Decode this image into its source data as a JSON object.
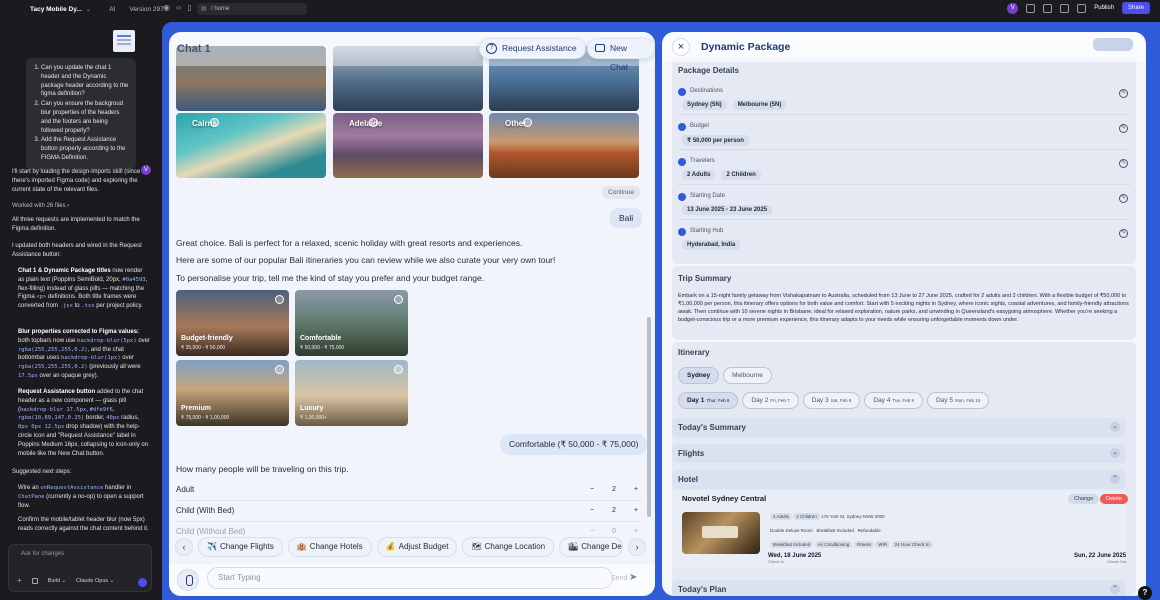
{
  "topbar": {
    "app_title": "Tacy Mobile Dy...",
    "ai_label": "AI",
    "version": "Version 297",
    "url": "/ home",
    "avatar": "V",
    "publish": "Publish",
    "share": "Share"
  },
  "left": {
    "user_points": [
      "Can you update the chat 1 header and the Dynamic package header according to the figma definition?",
      "Can you ensure the backgroud blur properties of the headers and the footers are being followed properly?",
      "Add the Request Assistance button properly according to the FIGMA Definition."
    ],
    "avatar": "V",
    "intro": "I'll start by loading the design-imports skill (since there's imported Figma code) and exploring the current state of the relevant files.",
    "worked": "Worked with 26 files",
    "p1": "All three requests are implemented to match the Figma definition.",
    "p2": "I updated both headers and wired in the Request Assistance button:",
    "b1_title": "Chat 1 & Dynamic Package titles",
    "b1_a": " now render as plain text (Poppins SemiBold, 20px, ",
    "b1_code1": "#0a4593",
    "b1_b": ", flex-filling) instead of glass pills — matching the Figma ",
    "b1_code2": "<p>",
    "b1_c": " definitions. Both title frames were converted from ",
    "b1_code3": ".jsx",
    "b1_d": " to ",
    "b1_code4": ".tsx",
    "b1_e": " per project policy.",
    "b2_title": "Blur properties corrected to Figma values:",
    "b2_a": " both topbars now use ",
    "b2_code1": "backdrop-blur(5px)",
    "b2_b": " over ",
    "b2_code2": "rgba(255,255,255,0.2)",
    "b2_c": ", and the chat bottombar uses ",
    "b2_code3": "backdrop-blur(1px)",
    "b2_d": " over ",
    "b2_code4": "rgba(255,255,255,0.2)",
    "b2_e": " (previously all were ",
    "b2_code5": "17.5px",
    "b2_f": " over an opaque grey).",
    "b3_title": "Request Assistance button",
    "b3_a": " added to the chat header as a new component — glass pill (",
    "b3_code1": "backdrop-blur 17.5px",
    "b3_b": ", ",
    "b3_code2": "#dfe9f6",
    "b3_c": ", ",
    "b3_code3": "rgba(10,69,147,0.25)",
    "b3_d": " border, ",
    "b3_code4": "40px",
    "b3_e": " radius, ",
    "b3_code5": "0px 0px 12.5px",
    "b3_f": " drop shadow) with the help-circle icon and \"Request Assistance\" label in Poppins Medium 16px, collapsing to icon-only on mobile like the New Chat button.",
    "next_title": "Suggested next steps:",
    "n1_a": "Wire an ",
    "n1_code": "onRequestAssistance",
    "n1_b": " handler in ",
    "n1_code2": "ChatPane",
    "n1_c": " (currently a no-op) to open a support flow.",
    "n2": "Confirm the mobile/tablet header blur (now 5px) reads correctly against the chat content behind it.",
    "ask_placeholder": "Ask for changes",
    "build": "Build",
    "model": "Claude Opus"
  },
  "chat": {
    "title": "Chat 1",
    "request_assistance": "Request Assistance",
    "new_chat": "New Chat",
    "cities": [
      {
        "name": "Cairns"
      },
      {
        "name": "Adelaide"
      },
      {
        "name": "Other"
      }
    ],
    "continue": "Continue",
    "user_reply": "Bali",
    "bot_1": "Great choice. Bali is perfect for a relaxed, scenic holiday with great resorts and experiences.",
    "bot_2": "Here are some of our popular Bali itineraries you can review while we also curate your very own tour!",
    "bot_3": "To personalise your trip, tell me the kind of stay you prefer and your budget range.",
    "packages": [
      {
        "title": "Budget-friendly",
        "price": "₹ 35,000 - ₹ 50,000"
      },
      {
        "title": "Comfortable",
        "price": "₹ 50,000 - ₹ 75,000"
      },
      {
        "title": "Premium",
        "price": "₹ 75,000 - ₹ 1,00,000"
      },
      {
        "title": "Luxury",
        "price": "₹ 1,00,000+"
      }
    ],
    "user_reply_2": "Comfortable (₹ 50,000 - ₹ 75,000)",
    "bot_4": "How many people will be traveling on this trip.",
    "rows": [
      {
        "label": "Adult",
        "value": "2"
      },
      {
        "label": "Child (With Bed)",
        "value": "2"
      },
      {
        "label": "Child (Without Bed)",
        "value": "0"
      }
    ],
    "chips": [
      {
        "emoji": "✈️",
        "label": "Change Flights"
      },
      {
        "emoji": "🏨",
        "label": "Change Hotels"
      },
      {
        "emoji": "💰",
        "label": "Adjust Budget"
      },
      {
        "emoji": "🗺",
        "label": "Change Location"
      },
      {
        "emoji": "🏙",
        "label": "Change Dep"
      }
    ],
    "composer_placeholder": "Start Typing",
    "send": "Send"
  },
  "package": {
    "title": "Dynamic Package",
    "details_title": "Package Details",
    "details": [
      {
        "key": "Destinations",
        "values": [
          "Sydney (5N)",
          "Melbourne (5N)"
        ]
      },
      {
        "key": "Budget",
        "values": [
          "₹ 50,000 per person"
        ]
      },
      {
        "key": "Travelers",
        "values": [
          "2 Adults",
          "2 Children"
        ]
      },
      {
        "key": "Starting Date",
        "values": [
          "13 June 2025 - 23 June 2025"
        ]
      },
      {
        "key": "Starting Hub",
        "values": [
          "Hyderabad, India"
        ]
      }
    ],
    "trip_summary_title": "Trip Summary",
    "trip_summary": "Embark on a 15-night family getaway from Vishakapatnam to Australia, scheduled from 13 June to 27 June 2025, crafted for 2 adults and 2 children. With a flexible budget of ₹50,000 to ₹1,00,000 per person, this itinerary offers options for both value and comfort. Start with 5 exciting nights in Sydney, where iconic sights, coastal adventures, and family-friendly attractions await. Then continue with 10 serene nights in Brisbane, ideal for relaxed exploration, nature parks, and unwinding in Queensland's easygoing atmosphere. Whether you're seeking a budget-conscious trip or a more premium experience, this itinerary adapts to your needs while ensuring unforgettable moments down under.",
    "itinerary_title": "Itinerary",
    "cities": [
      "Sydney",
      "Melbourne"
    ],
    "days": [
      {
        "label": "Day 1",
        "date": "Thur, Feb 6"
      },
      {
        "label": "Day 2",
        "date": "Fri, Feb 7"
      },
      {
        "label": "Day 3",
        "date": "Sat, Feb 8"
      },
      {
        "label": "Day 4",
        "date": "Tue, Feb 9"
      },
      {
        "label": "Day 5",
        "date": "Mon, Feb 10"
      }
    ],
    "todays_summary": "Today's Summary",
    "flights": "Flights",
    "hotel": "Hotel",
    "hotel_name": "Novotel Sydney Central",
    "change": "Change",
    "delete": "Delete",
    "amenities_row1": [
      "4 Adults",
      "2 Children",
      "176 York St, Sydney NSW 2000"
    ],
    "amenities_row2": [
      "Double Deluxe Room",
      "Breakfast Included",
      "Refundable"
    ],
    "amenities_row3": [
      "Breakfast Included",
      "Air Conditioning",
      "Fitness",
      "WiFi",
      "24 Hour Check In"
    ],
    "checkin_label": "Check In",
    "checkin": "Wed, 18 June 2025",
    "checkout_label": "Check Out",
    "checkout": "Sun, 22 June 2025",
    "todays_plan": "Today's Plan"
  }
}
